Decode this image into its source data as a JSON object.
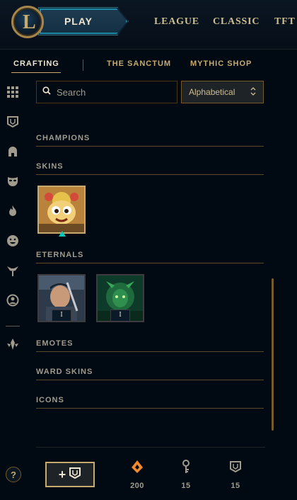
{
  "topbar": {
    "play_label": "PLAY",
    "nav": [
      "LEAGUE",
      "CLASSIC",
      "TFT"
    ]
  },
  "subnav": {
    "items": [
      "CRAFTING",
      "THE SANCTUM",
      "MYTHIC SHOP"
    ],
    "active": "CRAFTING"
  },
  "search": {
    "placeholder": "Search"
  },
  "sort": {
    "selected": "Alphabetical"
  },
  "sections": {
    "champions": "CHAMPIONS",
    "skins": "SKINS",
    "eternals": "ETERNALS",
    "emotes": "EMOTES",
    "ward_skins": "WARD SKINS",
    "icons": "ICONS"
  },
  "eternals": [
    {
      "level": "I"
    },
    {
      "level": "I"
    }
  ],
  "currencies": [
    {
      "icon": "orange-essence-icon",
      "value": "200"
    },
    {
      "icon": "key-icon",
      "value": "15"
    },
    {
      "icon": "chest-icon",
      "value": "15"
    }
  ],
  "footer": {
    "help": "?",
    "add_plus": "+"
  },
  "colors": {
    "gold": "#c8aa6e",
    "teal": "#0ac8b9",
    "orange": "#f08a2c",
    "bg": "#010a13"
  }
}
